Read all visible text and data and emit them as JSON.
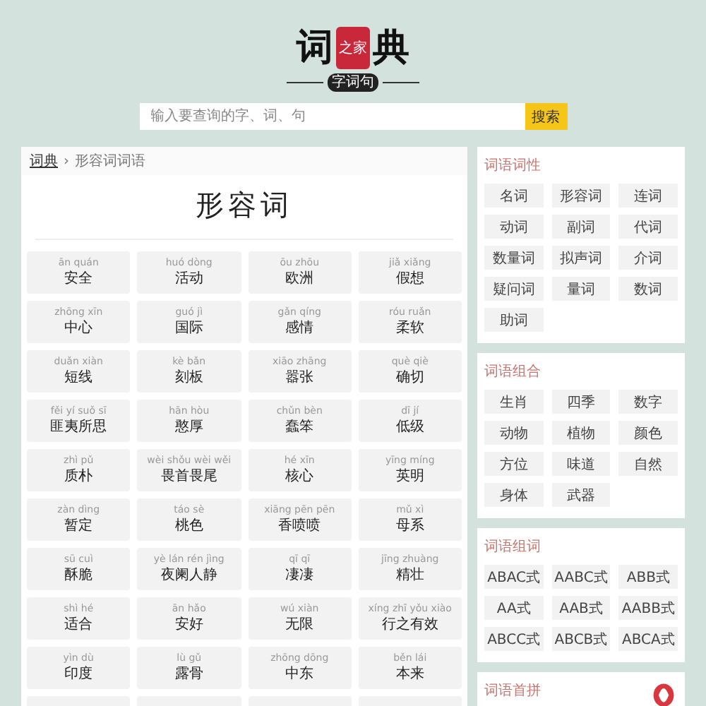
{
  "logo": {
    "left": "词",
    "seal": "之家",
    "right": "典",
    "subtitle": "字词句"
  },
  "search": {
    "placeholder": "输入要查询的字、词、句",
    "button": "搜索"
  },
  "breadcrumb": {
    "home": "词典",
    "separator": "›",
    "current": "形容词词语"
  },
  "heading": "形容词",
  "words": [
    {
      "pinyin": "ān quán",
      "word": "安全"
    },
    {
      "pinyin": "huó dòng",
      "word": "活动"
    },
    {
      "pinyin": "ōu zhōu",
      "word": "欧洲"
    },
    {
      "pinyin": "jiǎ xiǎng",
      "word": "假想"
    },
    {
      "pinyin": "zhōng xīn",
      "word": "中心"
    },
    {
      "pinyin": "guó jì",
      "word": "国际"
    },
    {
      "pinyin": "gǎn qíng",
      "word": "感情"
    },
    {
      "pinyin": "róu ruǎn",
      "word": "柔软"
    },
    {
      "pinyin": "duǎn xiàn",
      "word": "短线"
    },
    {
      "pinyin": "kè bǎn",
      "word": "刻板"
    },
    {
      "pinyin": "xiāo zhāng",
      "word": "嚣张"
    },
    {
      "pinyin": "què qiè",
      "word": "确切"
    },
    {
      "pinyin": "fěi yí suǒ sī",
      "word": "匪夷所思"
    },
    {
      "pinyin": "hān hòu",
      "word": "憨厚"
    },
    {
      "pinyin": "chǔn bèn",
      "word": "蠢笨"
    },
    {
      "pinyin": "dī jí",
      "word": "低级"
    },
    {
      "pinyin": "zhì pǔ",
      "word": "质朴"
    },
    {
      "pinyin": "wèi shǒu wèi wěi",
      "word": "畏首畏尾"
    },
    {
      "pinyin": "hé xīn",
      "word": "核心"
    },
    {
      "pinyin": "yīng míng",
      "word": "英明"
    },
    {
      "pinyin": "zàn dìng",
      "word": "暂定"
    },
    {
      "pinyin": "táo sè",
      "word": "桃色"
    },
    {
      "pinyin": "xiāng pēn pēn",
      "word": "香喷喷"
    },
    {
      "pinyin": "mǔ xì",
      "word": "母系"
    },
    {
      "pinyin": "sū cuì",
      "word": "酥脆"
    },
    {
      "pinyin": "yè lán rén jìng",
      "word": "夜阑人静"
    },
    {
      "pinyin": "qī qī",
      "word": "凄凄"
    },
    {
      "pinyin": "jīng zhuàng",
      "word": "精壮"
    },
    {
      "pinyin": "shì hé",
      "word": "适合"
    },
    {
      "pinyin": "ān hǎo",
      "word": "安好"
    },
    {
      "pinyin": "wú xiàn",
      "word": "无限"
    },
    {
      "pinyin": "xíng zhī yǒu xiào",
      "word": "行之有效"
    },
    {
      "pinyin": "yìn dù",
      "word": "印度"
    },
    {
      "pinyin": "lù gǔ",
      "word": "露骨"
    },
    {
      "pinyin": "zhōng dōng",
      "word": "中东"
    },
    {
      "pinyin": "běn lái",
      "word": "本来"
    }
  ],
  "sidebar": [
    {
      "title": "词语词性",
      "items": [
        "名词",
        "形容词",
        "连词",
        "动词",
        "副词",
        "代词",
        "数量词",
        "拟声词",
        "介词",
        "疑问词",
        "量词",
        "数词",
        "助词"
      ]
    },
    {
      "title": "词语组合",
      "items": [
        "生肖",
        "四季",
        "数字",
        "动物",
        "植物",
        "颜色",
        "方位",
        "味道",
        "自然",
        "身体",
        "武器"
      ]
    },
    {
      "title": "词语组词",
      "items": [
        "ABAC式",
        "AABC式",
        "ABB式",
        "AA式",
        "AAB式",
        "AABB式",
        "ABCC式",
        "ABCB式",
        "ABCA式"
      ]
    },
    {
      "title": "词语首拼"
    }
  ]
}
